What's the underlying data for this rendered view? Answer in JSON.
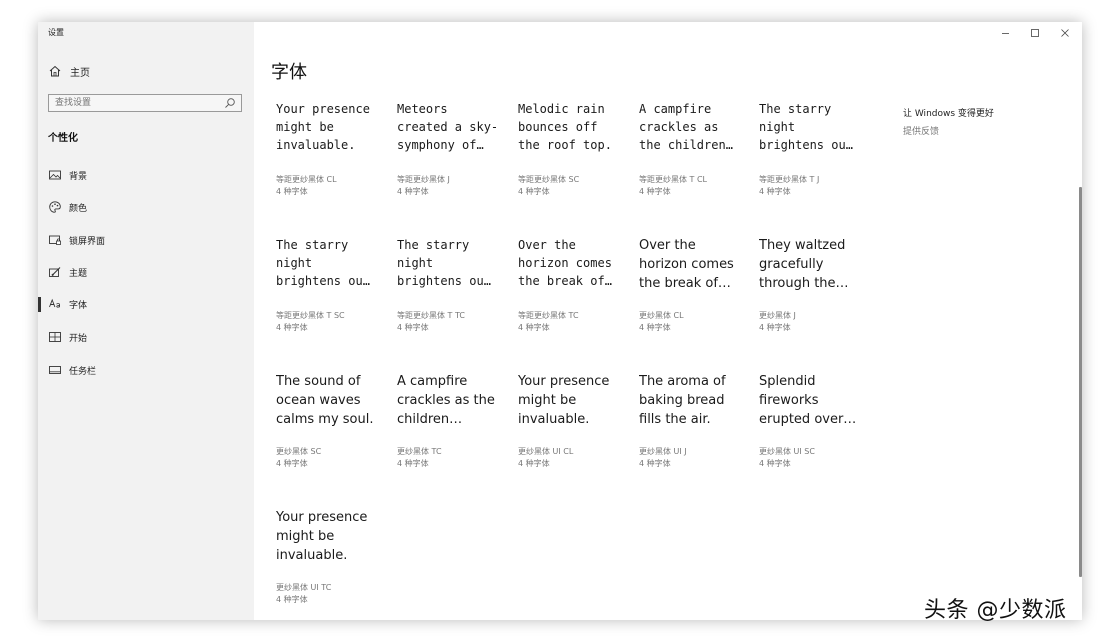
{
  "window": {
    "title": "设置"
  },
  "sidebar": {
    "home": {
      "label": "主页",
      "icon": "home-icon"
    },
    "search": {
      "placeholder": "查找设置",
      "icon": "search-icon"
    },
    "section": "个性化",
    "items": [
      {
        "label": "背景",
        "icon": "picture-icon"
      },
      {
        "label": "颜色",
        "icon": "palette-icon"
      },
      {
        "label": "锁屏界面",
        "icon": "lock-screen-icon"
      },
      {
        "label": "主题",
        "icon": "brush-icon"
      },
      {
        "label": "字体",
        "icon": "font-icon",
        "active": true
      },
      {
        "label": "开始",
        "icon": "start-icon"
      },
      {
        "label": "任务栏",
        "icon": "taskbar-icon"
      }
    ]
  },
  "main": {
    "title": "字体",
    "fonts": [
      {
        "preview": [
          "Your presence",
          "might be",
          "invaluable."
        ],
        "name": "等距更纱黑体 CL",
        "count": "4 种字体",
        "mono": true
      },
      {
        "preview": [
          "Meteors",
          "created a sky-",
          "symphony of…"
        ],
        "name": "等距更纱黑体 J",
        "count": "4 种字体",
        "mono": true
      },
      {
        "preview": [
          "Melodic rain",
          "bounces off",
          "the roof top."
        ],
        "name": "等距更纱黑体 SC",
        "count": "4 种字体",
        "mono": true
      },
      {
        "preview": [
          "A campfire",
          "crackles as",
          "the children…"
        ],
        "name": "等距更纱黑体 T CL",
        "count": "4 种字体",
        "mono": true
      },
      {
        "preview": [
          "The starry",
          "night",
          "brightens ou…"
        ],
        "name": "等距更纱黑体 T J",
        "count": "4 种字体",
        "mono": true
      },
      {
        "preview": [
          "The starry",
          "night",
          "brightens ou…"
        ],
        "name": "等距更纱黑体 T SC",
        "count": "4 种字体",
        "mono": true
      },
      {
        "preview": [
          "The starry",
          "night",
          "brightens ou…"
        ],
        "name": "等距更纱黑体 T TC",
        "count": "4 种字体",
        "mono": true
      },
      {
        "preview": [
          "Over the",
          "horizon comes",
          "the break of…"
        ],
        "name": "等距更纱黑体 TC",
        "count": "4 种字体",
        "mono": true
      },
      {
        "preview": [
          "Over the",
          "horizon comes",
          "the break of…"
        ],
        "name": "更纱黑体 CL",
        "count": "4 种字体",
        "mono": false
      },
      {
        "preview": [
          "They waltzed",
          "gracefully",
          "through the…"
        ],
        "name": "更纱黑体 J",
        "count": "4 种字体",
        "mono": false
      },
      {
        "preview": [
          "The sound of",
          "ocean waves",
          "calms my soul."
        ],
        "name": "更纱黑体 SC",
        "count": "4 种字体",
        "mono": false
      },
      {
        "preview": [
          "A campfire",
          "crackles as the",
          "children…"
        ],
        "name": "更纱黑体 TC",
        "count": "4 种字体",
        "mono": false
      },
      {
        "preview": [
          "Your presence",
          "might be",
          "invaluable."
        ],
        "name": "更纱黑体 UI CL",
        "count": "4 种字体",
        "mono": false
      },
      {
        "preview": [
          "The aroma of",
          "baking bread",
          "fills the air."
        ],
        "name": "更纱黑体 UI J",
        "count": "4 种字体",
        "mono": false
      },
      {
        "preview": [
          "Splendid",
          "fireworks",
          "erupted over…"
        ],
        "name": "更纱黑体 UI SC",
        "count": "4 种字体",
        "mono": false
      },
      {
        "preview": [
          "Your presence",
          "might be",
          "invaluable."
        ],
        "name": "更纱黑体 UI TC",
        "count": "4 种字体",
        "mono": false
      }
    ]
  },
  "aside": {
    "heading": "让 Windows 变得更好",
    "feedback": "提供反馈"
  },
  "controls": {
    "minimize": "minimize-icon",
    "maximize": "maximize-icon",
    "close": "close-icon"
  },
  "watermark": "头条 @少数派"
}
